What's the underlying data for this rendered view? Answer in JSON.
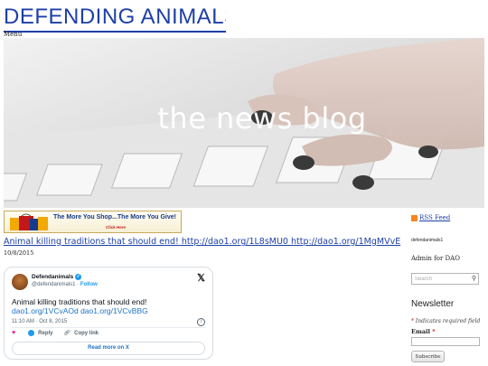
{
  "site": {
    "title": "DEFENDING ANIMALS ONLINE",
    "menu_label": "Menu",
    "accent_color": "#1d3fa6"
  },
  "hero": {
    "text": "the news blog",
    "image_icon": "keyboard-typing-photo"
  },
  "ad": {
    "main_text": "The More You Shop...The More You Give!",
    "sub_text": "Click Here"
  },
  "post": {
    "title": "Animal killing traditions that should end! http://dao1.org/1L8sMU0 http://dao1.org/1MgMVvE",
    "date": "10/8/2015"
  },
  "tweet": {
    "name": "Defendanimals",
    "handle": "@defendanimals1",
    "separator": "·",
    "follow_label": "Follow",
    "text": "Animal killing traditions that should end!",
    "links": "dao1.org/1VCvAOd dao1.org/1VCvBBG",
    "meta": "11:10 AM · Oct 8, 2015",
    "reply_label": "Reply",
    "copy_label": "Copy link",
    "read_more_label": "Read more on X",
    "verified_color": "#1d9bf0",
    "like_color": "#f91880"
  },
  "sidebar": {
    "rss_label": "RSS Feed",
    "author_name": "defendanimals1",
    "author_role": "Admin for DAO",
    "search_placeholder": "Search",
    "newsletter_title": "Newsletter",
    "required_note": "Indicates required field",
    "email_label": "Email",
    "subscribe_label": "Subscribe"
  }
}
